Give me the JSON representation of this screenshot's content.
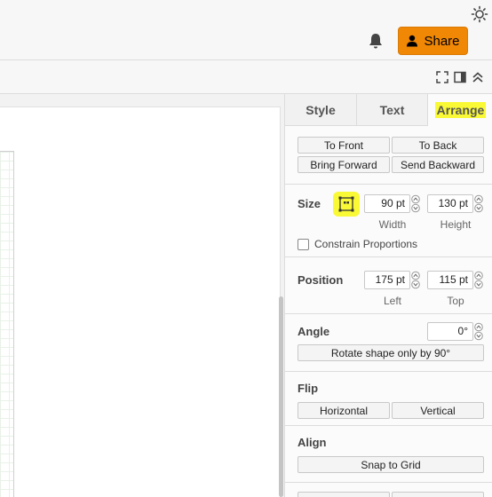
{
  "header": {
    "share_label": "Share",
    "icons": {
      "theme": "sun-icon",
      "notifications": "bell-icon",
      "share": "user-icon"
    }
  },
  "toolbar": {
    "icons": [
      "fullscreen-icon",
      "format-panel-icon",
      "collapse-icon"
    ]
  },
  "panel": {
    "tabs": [
      {
        "label": "Style"
      },
      {
        "label": "Text"
      },
      {
        "label": "Arrange"
      }
    ],
    "order": {
      "to_front": "To Front",
      "to_back": "To Back",
      "bring_forward": "Bring Forward",
      "send_backward": "Send Backward"
    },
    "size": {
      "label": "Size",
      "width_value": "90 pt",
      "height_value": "130 pt",
      "width_label": "Width",
      "height_label": "Height",
      "constrain_label": "Constrain Proportions"
    },
    "position": {
      "label": "Position",
      "left_value": "175 pt",
      "top_value": "115 pt",
      "left_label": "Left",
      "top_label": "Top"
    },
    "angle": {
      "label": "Angle",
      "value": "0°",
      "rotate_label": "Rotate shape only by 90°"
    },
    "flip": {
      "label": "Flip",
      "horizontal": "Horizontal",
      "vertical": "Vertical"
    },
    "align": {
      "label": "Align",
      "snap_label": "Snap to Grid"
    }
  },
  "colors": {
    "accent": "#f08705",
    "highlight": "#f9f936"
  }
}
